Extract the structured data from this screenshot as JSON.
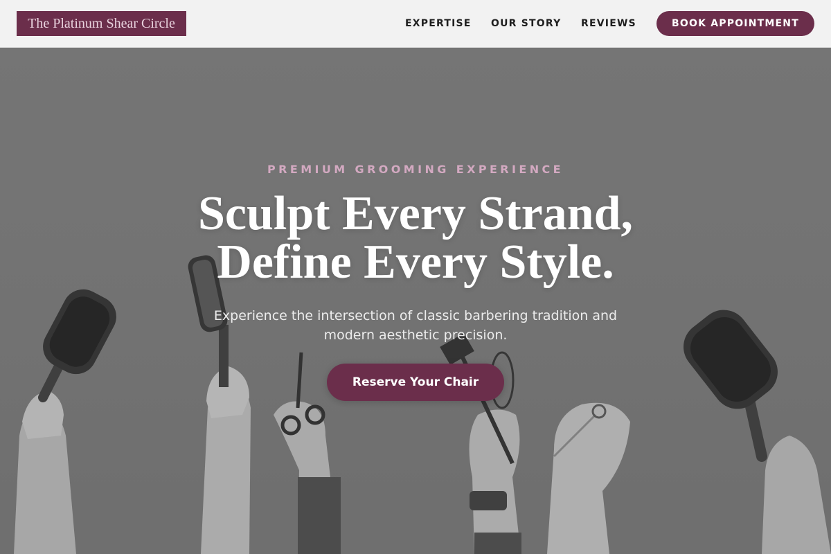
{
  "header": {
    "logo_text": "The Platinum Shear Circle",
    "nav": {
      "expertise": "EXPERTISE",
      "our_story": "OUR STORY",
      "reviews": "REVIEWS"
    },
    "book_button": "BOOK APPOINTMENT"
  },
  "hero": {
    "eyebrow": "PREMIUM GROOMING EXPERIENCE",
    "headline_line1": "Sculpt Every Strand,",
    "headline_line2": "Define Every Style.",
    "subtext": "Experience the intersection of classic barbering tradition and modern aesthetic precision.",
    "cta_label": "Reserve Your Chair",
    "background_image_icons": [
      "paddle-brush-icon",
      "round-brush-icon",
      "scissors-icon",
      "tint-brush-icon",
      "whisk-icon",
      "scissors-icon",
      "paddle-brush-icon",
      "wristwatch-icon"
    ]
  },
  "colors": {
    "accent": "#6b2e4b",
    "eyebrow": "#d3a9c1",
    "header_bg": "#f2f2f2",
    "hero_bg": "#7a7a7a"
  }
}
